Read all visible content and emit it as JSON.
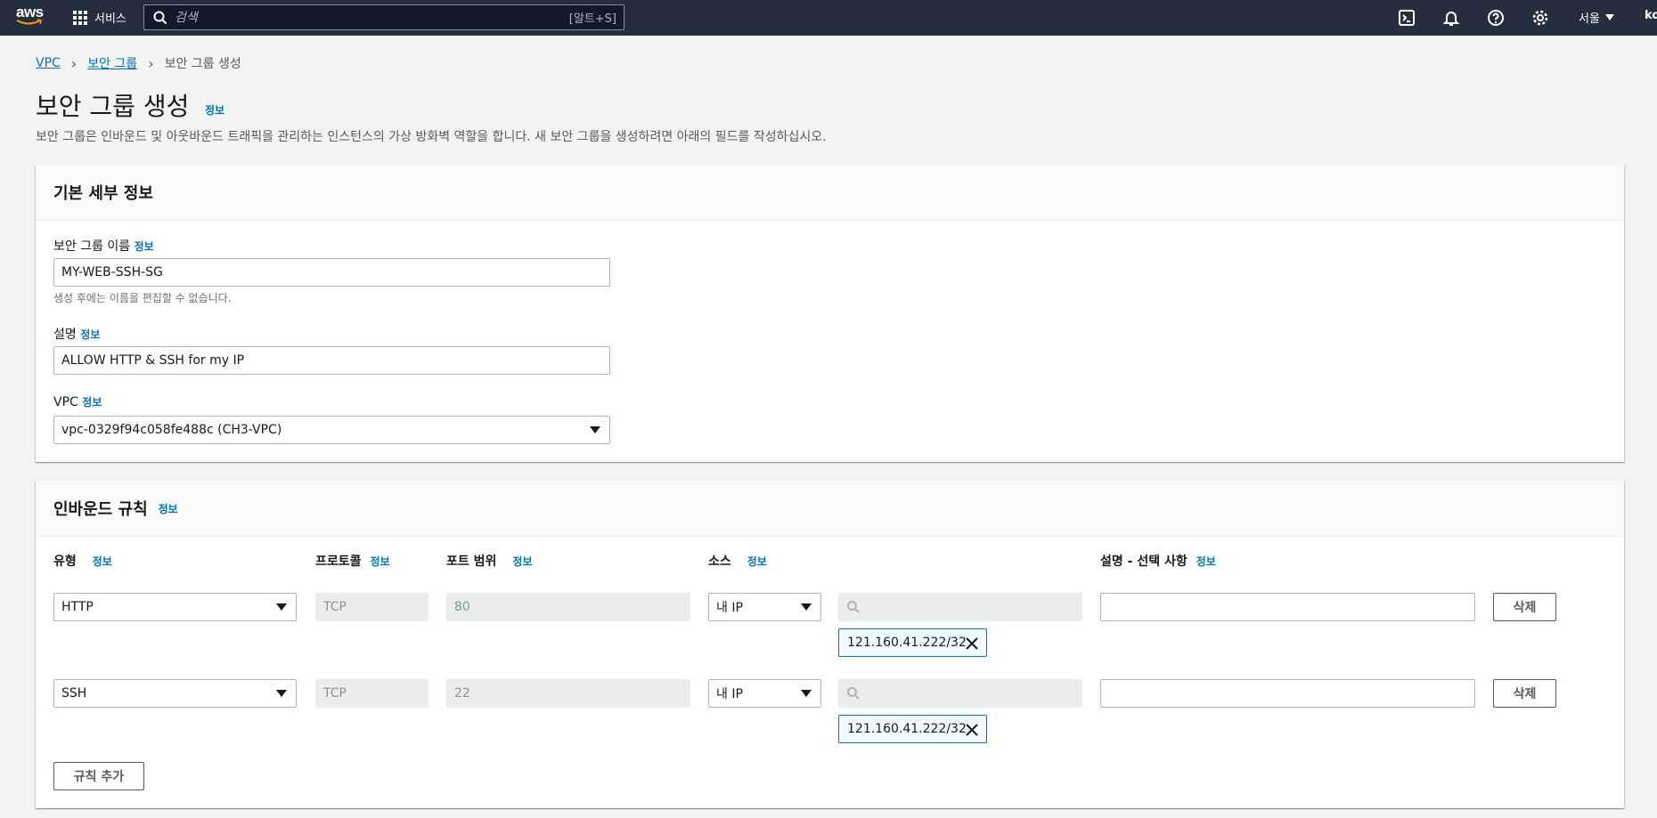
{
  "topbar": {
    "logo_text": "aws",
    "services_label": "서비스",
    "search_placeholder": "검색",
    "search_shortcut": "[알트+S]",
    "icons": [
      "cloudshell-icon",
      "bell-icon",
      "help-icon",
      "gear-icon"
    ],
    "region": "서울",
    "account": "ko"
  },
  "breadcrumb": {
    "items": [
      "VPC",
      "보안 그룹"
    ],
    "current": "보안 그룹 생성"
  },
  "page": {
    "title": "보안 그룹 생성",
    "info": "정보",
    "description": "보안 그룹은 인바운드 및 아웃바운드 트래픽을 관리하는 인스턴스의 가상 방화벽 역할을 합니다. 새 보안 그룹을 생성하려면 아래의 필드를 작성하십시오."
  },
  "basic": {
    "header": "기본 세부 정보",
    "name_label": "보안 그룹 이름",
    "name_value": "MY-WEB-SSH-SG",
    "name_hint": "생성 후에는 이름을 편집할 수 없습니다.",
    "desc_label": "설명",
    "desc_value": "ALLOW HTTP & SSH for my IP",
    "vpc_label": "VPC",
    "vpc_value": "vpc-0329f94c058fe488c (CH3-VPC)"
  },
  "inbound": {
    "header": "인바운드 규칙",
    "columns": {
      "type": "유형",
      "protocol": "프로토콜",
      "port": "포트 범위",
      "source": "소스",
      "description": "설명 - 선택 사항"
    },
    "rules": [
      {
        "type": "HTTP",
        "protocol": "TCP",
        "port": "80",
        "source": "내 IP",
        "cidr": "121.160.41.222/32",
        "delete": "삭제"
      },
      {
        "type": "SSH",
        "protocol": "TCP",
        "port": "22",
        "source": "내 IP",
        "cidr": "121.160.41.222/32",
        "delete": "삭제"
      }
    ],
    "add_rule": "규칙 추가"
  },
  "colors": {
    "topbar": "#232f3e",
    "link": "#0073bb",
    "background": "#f2f3f3"
  }
}
